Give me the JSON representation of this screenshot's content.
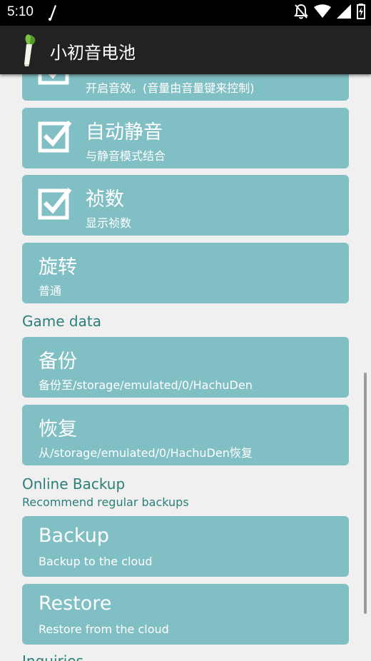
{
  "status_bar": {
    "time": "5:10",
    "icons": [
      "notification-icon",
      "do-not-disturb-icon",
      "wifi-icon",
      "signal-icon",
      "battery-icon"
    ]
  },
  "app_bar": {
    "title": "小初音电池"
  },
  "prefs": {
    "sound": {
      "summary": "开启音效。(音量由音量键来控制)",
      "checked": true
    },
    "auto_mute": {
      "title": "自动静音",
      "summary": "与静音模式结合",
      "checked": true
    },
    "frames": {
      "title": "祯数",
      "summary": "显示祯数",
      "checked": true
    },
    "rotate": {
      "title": "旋转",
      "summary": "普通"
    },
    "backup": {
      "title": "备份",
      "summary": "备份至/storage/emulated/0/HachuDen"
    },
    "restore": {
      "title": "恢复",
      "summary": "从/storage/emulated/0/HachuDen恢复"
    },
    "online_backup": {
      "title": "Backup",
      "summary": "Backup to the cloud"
    },
    "online_restore": {
      "title": "Restore",
      "summary": "Restore from the cloud"
    }
  },
  "sections": {
    "game_data": "Game data",
    "online_backup": "Online Backup",
    "online_backup_sub": "Recommend regular backups",
    "inquiries": "Inquiries"
  },
  "colors": {
    "card": "#80bfc4",
    "section_text": "#2a7f78",
    "appbar": "#222222",
    "background": "#f0f0f0"
  }
}
